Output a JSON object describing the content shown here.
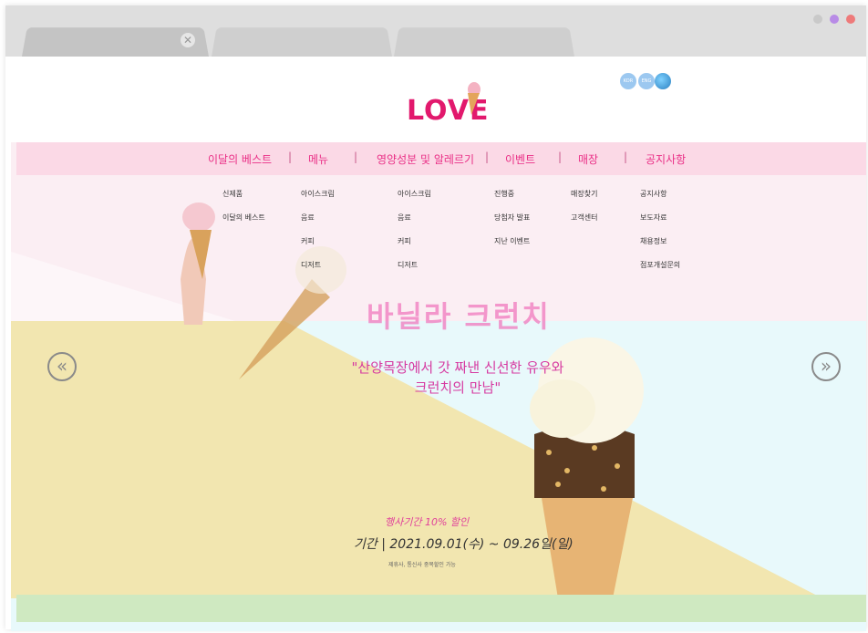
{
  "browser": {
    "tabs": [
      {
        "label": ""
      },
      {
        "label": ""
      },
      {
        "label": ""
      }
    ],
    "close_glyph": "✕",
    "window_dots": [
      "#c9c9c9",
      "#b88be6",
      "#ee7a7a"
    ]
  },
  "header": {
    "logo": "LOVE",
    "lang_buttons": [
      "KOR",
      "ENG"
    ]
  },
  "nav": {
    "items": [
      "이달의 베스트",
      "메뉴",
      "영양성분 및 알레르기",
      "이벤트",
      "매장",
      "공지사항"
    ],
    "separator": "|"
  },
  "submenu": {
    "columns": [
      [
        "신제품",
        "이달의 베스트"
      ],
      [
        "아이스크림",
        "음료",
        "커피",
        "디저트"
      ],
      [
        "아이스크림",
        "음료",
        "커피",
        "디저트"
      ],
      [
        "진행중",
        "당첨자 발표",
        "지난 이벤트"
      ],
      [
        "매장찾기",
        "고객센터"
      ],
      [
        "공지사항",
        "보도자료",
        "채용정보",
        "점포개설문의"
      ]
    ]
  },
  "banner": {
    "title": "바닐라 크런치",
    "quote_line1": "\"산양목장에서 갓 짜낸 신선한 유우와",
    "quote_line2": "크런치의 만남\"",
    "promo": "행사기간 10% 할인",
    "period": "기간 | 2021.09.01(수) ~ 09.26일(일)",
    "note": "제휴사, 통신사 중복할인 가능",
    "prev_glyph": "«",
    "next_glyph": "»"
  },
  "colors": {
    "accent": "#e2196d",
    "nav_bg": "#fbd9e6",
    "banner_yellow": "#f2e6b0",
    "banner_blue": "#e6f8fb",
    "footer_green": "#cfe9c1"
  }
}
